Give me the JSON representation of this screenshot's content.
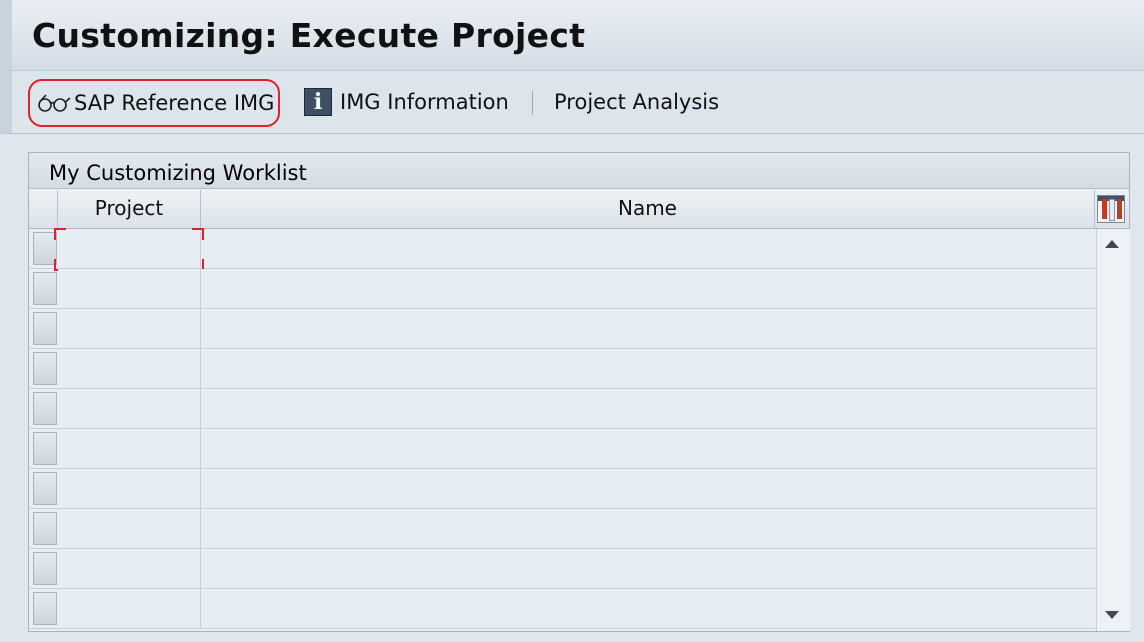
{
  "window": {
    "title": "Customizing: Execute Project"
  },
  "toolbar": {
    "sap_reference_img": {
      "label": "SAP Reference IMG",
      "icon": "glasses-icon"
    },
    "img_information": {
      "label": "IMG Information",
      "icon": "info-icon"
    },
    "project_analysis": {
      "label": "Project Analysis"
    }
  },
  "worklist": {
    "title": "My Customizing Worklist",
    "columns": [
      "Project",
      "Name"
    ],
    "rows": [
      {
        "project": "",
        "name": ""
      },
      {
        "project": "",
        "name": ""
      },
      {
        "project": "",
        "name": ""
      },
      {
        "project": "",
        "name": ""
      },
      {
        "project": "",
        "name": ""
      },
      {
        "project": "",
        "name": ""
      },
      {
        "project": "",
        "name": ""
      },
      {
        "project": "",
        "name": ""
      },
      {
        "project": "",
        "name": ""
      },
      {
        "project": "",
        "name": ""
      }
    ]
  },
  "colors": {
    "highlight": "#e0212b",
    "background": "#dfe6ed"
  }
}
